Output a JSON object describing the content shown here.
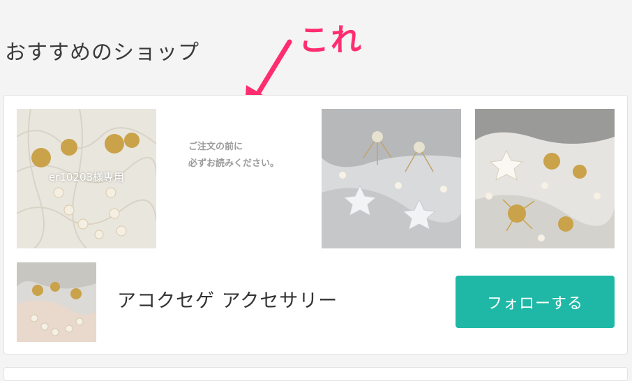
{
  "section": {
    "title": "おすすめのショップ"
  },
  "annotation": {
    "text": "これ",
    "color": "#ff2d6f"
  },
  "shop": {
    "name": "アコクセゲ アクセサリー",
    "follow_label": "フォローする",
    "follow_color": "#1fb8a6",
    "products": [
      {
        "overlay_text": "er10203様専用"
      },
      {
        "notice_lines": [
          "ご注文の前に",
          "必ずお読みください。"
        ]
      },
      {},
      {}
    ]
  }
}
